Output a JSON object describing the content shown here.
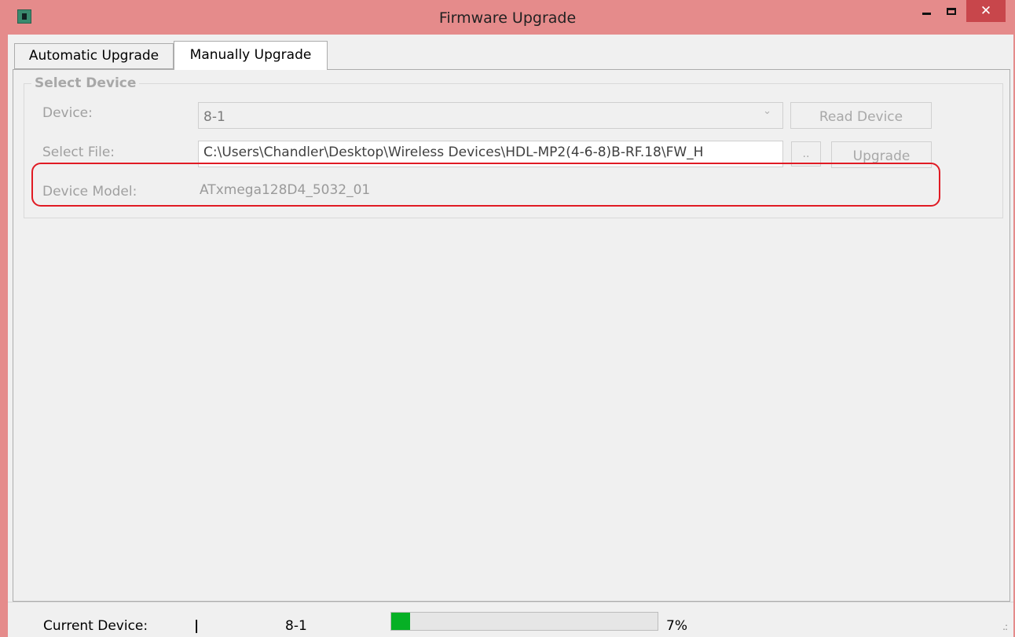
{
  "window": {
    "title": "Firmware Upgrade",
    "close_symbol": "✕"
  },
  "tabs": [
    {
      "label": "Automatic Upgrade",
      "selected": false
    },
    {
      "label": "Manually Upgrade",
      "selected": true
    }
  ],
  "select_device": {
    "group_title": "Select Device",
    "device_label": "Device:",
    "device_value": "8-1",
    "read_device_label": "Read Device",
    "select_file_label": "Select File:",
    "file_path": "C:\\Users\\Chandler\\Desktop\\Wireless Devices\\HDL-MP2(4-6-8)B-RF.18\\FW_H",
    "browse_label": "..",
    "upgrade_label": "Upgrade",
    "device_model_label": "Device Model:",
    "device_model_value": "ATxmega128D4_5032_01"
  },
  "status": {
    "current_device_label": "Current Device:",
    "separator": "|",
    "current_device_value": "8-1",
    "progress_fraction": 0.07,
    "progress_text": "7%"
  },
  "icons": {
    "app": "app-chip-icon",
    "minimize": "minimize-icon",
    "maximize": "maximize-icon",
    "close": "close-icon",
    "dropdown": "chevron-down-icon",
    "grip": "resize-grip-icon"
  },
  "colors": {
    "titlebar": "#e58b8b",
    "close_button": "#c8464b",
    "highlight": "#e01b24",
    "progress": "#06b025"
  }
}
